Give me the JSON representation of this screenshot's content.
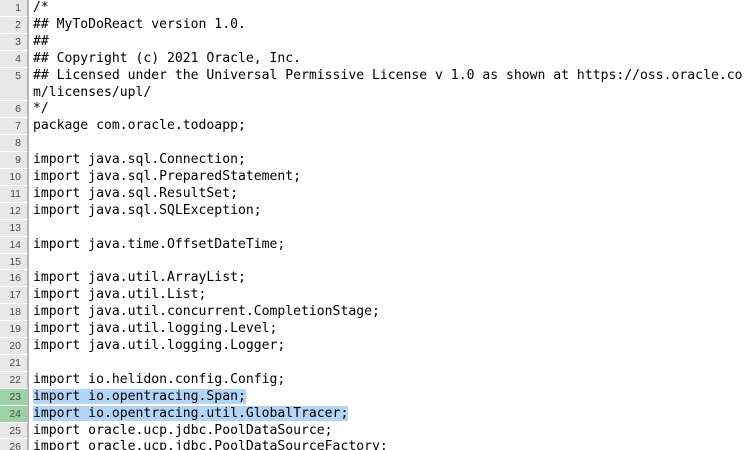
{
  "editor": {
    "lines": [
      {
        "number": "1",
        "text": "/*"
      },
      {
        "number": "2",
        "text": "## MyToDoReact version 1.0."
      },
      {
        "number": "3",
        "text": "##"
      },
      {
        "number": "4",
        "text": "## Copyright (c) 2021 Oracle, Inc."
      },
      {
        "number": "5",
        "text": "## Licensed under the Universal Permissive License v 1.0 as shown at https://oss.oracle.com/licenses/upl/"
      },
      {
        "number": "6",
        "text": "*/"
      },
      {
        "number": "7",
        "text": "package com.oracle.todoapp;"
      },
      {
        "number": "8",
        "text": ""
      },
      {
        "number": "9",
        "text": "import java.sql.Connection;"
      },
      {
        "number": "10",
        "text": "import java.sql.PreparedStatement;"
      },
      {
        "number": "11",
        "text": "import java.sql.ResultSet;"
      },
      {
        "number": "12",
        "text": "import java.sql.SQLException;"
      },
      {
        "number": "13",
        "text": ""
      },
      {
        "number": "14",
        "text": "import java.time.OffsetDateTime;"
      },
      {
        "number": "15",
        "text": ""
      },
      {
        "number": "16",
        "text": "import java.util.ArrayList;"
      },
      {
        "number": "17",
        "text": "import java.util.List;"
      },
      {
        "number": "18",
        "text": "import java.util.concurrent.CompletionStage;"
      },
      {
        "number": "19",
        "text": "import java.util.logging.Level;"
      },
      {
        "number": "20",
        "text": "import java.util.logging.Logger;"
      },
      {
        "number": "21",
        "text": ""
      },
      {
        "number": "22",
        "text": "import io.helidon.config.Config;"
      },
      {
        "number": "23",
        "text": "import io.opentracing.Span;",
        "highlighted": true
      },
      {
        "number": "24",
        "text": "import io.opentracing.util.GlobalTracer;",
        "highlighted": true
      },
      {
        "number": "25",
        "text": "import oracle.ucp.jdbc.PoolDataSource;"
      },
      {
        "number": "26",
        "text": "import oracle.ucp.jdbc.PoolDataSourceFactory;"
      }
    ],
    "colors": {
      "gutter_background": "#e8e8e8",
      "gutter_highlight": "#9cd3a5",
      "selection": "#b3d4f5"
    }
  }
}
